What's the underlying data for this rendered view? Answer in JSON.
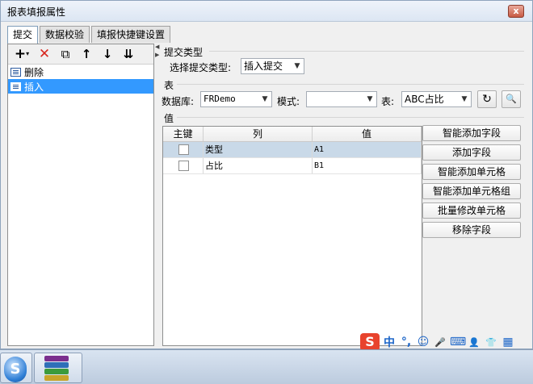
{
  "window": {
    "title": "报表填报属性",
    "close_glyph": "x"
  },
  "tabs": [
    {
      "label": "提交",
      "active": true
    },
    {
      "label": "数据校验",
      "active": false
    },
    {
      "label": "填报快捷键设置",
      "active": false
    }
  ],
  "left_toolbar": {
    "add": "+",
    "add_drop": "▾",
    "remove": "✕",
    "copy": "⧉",
    "up": "↑",
    "down": "↓",
    "sort": "⇊"
  },
  "submit_items": [
    {
      "label": "删除",
      "selected": false
    },
    {
      "label": "插入",
      "selected": true
    }
  ],
  "submit_type": {
    "section": "提交类型",
    "label": "选择提交类型:",
    "value": "插入提交"
  },
  "table_section": {
    "section": "表",
    "db_label": "数据库:",
    "db_value": "FRDemo",
    "mode_label": "模式:",
    "mode_value": "",
    "table_label": "表:",
    "table_value": "ABC占比",
    "refresh_icon": "↻",
    "preview_icon": "🔍"
  },
  "values_section": {
    "section": "值",
    "columns": [
      "主键",
      "列",
      "值"
    ],
    "rows": [
      {
        "key": false,
        "column": "类型",
        "value": "A1",
        "selected": true
      },
      {
        "key": false,
        "column": "占比",
        "value": "B1",
        "selected": false
      }
    ]
  },
  "actions": [
    "智能添加字段",
    "添加字段",
    "智能添加单元格",
    "智能添加单元格组",
    "批量修改单元格",
    "移除字段"
  ],
  "ime": {
    "logo": "S",
    "lang": "中",
    "punct": "°,",
    "emoji": "☺",
    "mic": "🎤",
    "kbd": "⌨",
    "user": "👤",
    "shirt": "👕",
    "grid": "▦"
  },
  "taskbar": {
    "start": "S"
  },
  "colors": {
    "selection": "#3399ff",
    "grid_selection": "#c9d9e8",
    "delete_icon": "#d8261e"
  }
}
